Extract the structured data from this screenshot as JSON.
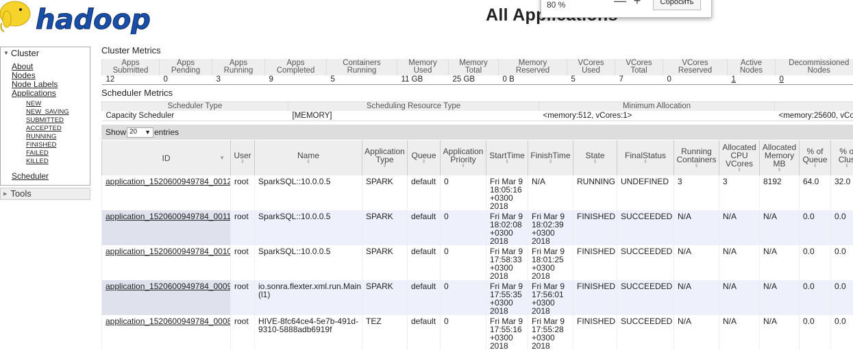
{
  "logo": {
    "text": "hadoop"
  },
  "page_title": "All Applications",
  "zoom_popup": {
    "zoom": "80 %",
    "minus": "—",
    "plus": "+",
    "reset": "Сбросить"
  },
  "sidebar": {
    "cluster_label": "Cluster",
    "links": [
      "About",
      "Nodes",
      "Node Labels",
      "Applications"
    ],
    "app_states": [
      "NEW",
      "NEW_SAVING",
      "SUBMITTED",
      "ACCEPTED",
      "RUNNING",
      "FINISHED",
      "FAILED",
      "KILLED"
    ],
    "scheduler": "Scheduler",
    "tools": "Tools"
  },
  "cluster_metrics": {
    "title": "Cluster Metrics",
    "headers": [
      [
        "Apps",
        "Submitted"
      ],
      [
        "Apps",
        "Pending"
      ],
      [
        "Apps",
        "Running"
      ],
      [
        "Apps",
        "Completed"
      ],
      [
        "Containers",
        "Running"
      ],
      [
        "Memory",
        "Used"
      ],
      [
        "Memory",
        "Total"
      ],
      [
        "Memory",
        "Reserved"
      ],
      [
        "VCores",
        "Used"
      ],
      [
        "VCores",
        "Total"
      ],
      [
        "VCores",
        "Reserved"
      ],
      [
        "Active",
        "Nodes"
      ],
      [
        "Decommissioned",
        "Nodes"
      ]
    ],
    "values": [
      "12",
      "0",
      "3",
      "9",
      "5",
      "11 GB",
      "25 GB",
      "0 B",
      "5",
      "7",
      "0",
      "1",
      "0"
    ]
  },
  "scheduler_metrics": {
    "title": "Scheduler Metrics",
    "headers": [
      "Scheduler Type",
      "Scheduling Resource Type",
      "Minimum Allocation",
      ""
    ],
    "values": [
      "Capacity Scheduler",
      "[MEMORY]",
      "<memory:512, vCores:1>",
      "<memory:25600, vCo"
    ]
  },
  "show_entries": {
    "show": "Show",
    "count": "20",
    "entries": "entries"
  },
  "apps_table": {
    "headers": [
      [
        "ID"
      ],
      [
        "User"
      ],
      [
        "Name"
      ],
      [
        "Application",
        "Type"
      ],
      [
        "Queue"
      ],
      [
        "Application",
        "Priority"
      ],
      [
        "StartTime"
      ],
      [
        "FinishTime"
      ],
      [
        "State"
      ],
      [
        "FinalStatus"
      ],
      [
        "Running",
        "Containers"
      ],
      [
        "Allocated",
        "CPU",
        "VCores"
      ],
      [
        "Allocated",
        "Memory",
        "MB"
      ],
      [
        "% of",
        "Queue"
      ],
      [
        "% o",
        "Clus"
      ]
    ],
    "rows": [
      [
        "application_1520600949784_0012",
        "root",
        "SparkSQL::10.0.0.5",
        "SPARK",
        "default",
        "0",
        "Fri Mar 9 18:05:16 +0300 2018",
        "N/A",
        "RUNNING",
        "UNDEFINED",
        "3",
        "3",
        "8192",
        "64.0",
        "32.0"
      ],
      [
        "application_1520600949784_0011",
        "root",
        "SparkSQL::10.0.0.5",
        "SPARK",
        "default",
        "0",
        "Fri Mar 9 18:02:08 +0300 2018",
        "Fri Mar 9 18:02:39 +0300 2018",
        "FINISHED",
        "SUCCEEDED",
        "N/A",
        "N/A",
        "N/A",
        "0.0",
        "0.0"
      ],
      [
        "application_1520600949784_0010",
        "root",
        "SparkSQL::10.0.0.5",
        "SPARK",
        "default",
        "0",
        "Fri Mar 9 17:58:33 +0300 2018",
        "Fri Mar 9 18:01:25 +0300 2018",
        "FINISHED",
        "SUCCEEDED",
        "N/A",
        "N/A",
        "N/A",
        "0.0",
        "0.0"
      ],
      [
        "application_1520600949784_0009",
        "root",
        "io.sonra.flexter.xml.run.Main (l1)",
        "SPARK",
        "default",
        "0",
        "Fri Mar 9 17:55:35 +0300 2018",
        "Fri Mar 9 17:56:01 +0300 2018",
        "FINISHED",
        "SUCCEEDED",
        "N/A",
        "N/A",
        "N/A",
        "0.0",
        "0.0"
      ],
      [
        "application_1520600949784_0008",
        "root",
        "HIVE-8fc64ce4-5e7b-491d-9310-5888adb6919f",
        "TEZ",
        "default",
        "0",
        "Fri Mar 9 17:55:16 +0300 2018",
        "Fri Mar 9 17:55:28 +0300 2018",
        "FINISHED",
        "SUCCEEDED",
        "N/A",
        "N/A",
        "N/A",
        "0.0",
        "0.0"
      ]
    ]
  }
}
